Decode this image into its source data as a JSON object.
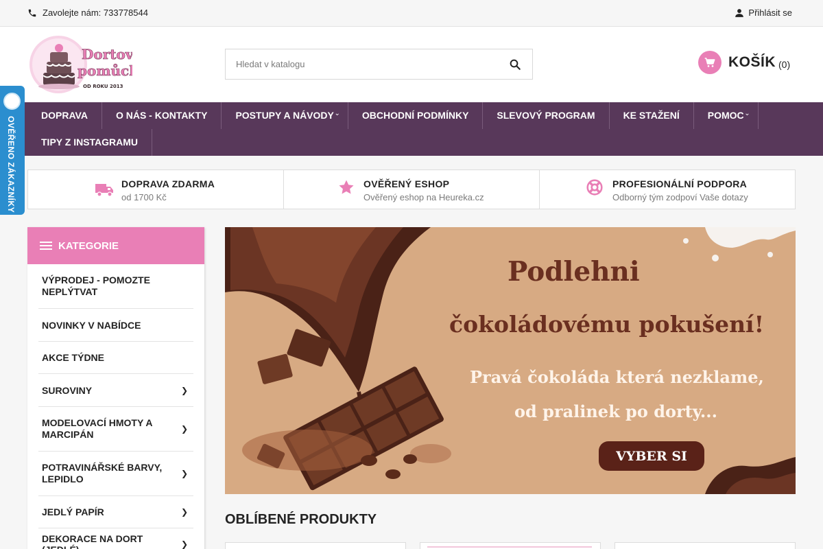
{
  "topbar": {
    "phone_text": "Zavolejte nám: 733778544",
    "login_text": "Přihlásit se"
  },
  "header": {
    "logo_icon": "cake-logo",
    "search_placeholder": "Hledat v katalogu",
    "cart_label": "KOŠÍK",
    "cart_count": "(0)"
  },
  "nav": {
    "row1": [
      {
        "label": "DOPRAVA"
      },
      {
        "label": "O NÁS - KONTAKTY"
      },
      {
        "label": "POSTUPY A NÁVODY"
      },
      {
        "label": "OBCHODNÍ PODMÍNKY"
      },
      {
        "label": "SLEVOVÝ PROGRAM"
      },
      {
        "label": "KE STAŽENÍ"
      },
      {
        "label": "POMOC"
      }
    ],
    "row2": [
      {
        "label": "TIPY Z INSTAGRAMU"
      }
    ]
  },
  "benefits": [
    {
      "icon": "truck-icon",
      "title": "DOPRAVA ZDARMA",
      "subtitle": "od 1700 Kč"
    },
    {
      "icon": "star-icon",
      "title": "OVĚŘENÝ ESHOP",
      "subtitle": "Ověřený eshop na Heureka.cz"
    },
    {
      "icon": "lifebuoy-icon",
      "title": "PROFESIONÁLNÍ PODPORA",
      "subtitle": "Odborný tým zodpoví Vaše dotazy"
    }
  ],
  "sidebar": {
    "title": "KATEGORIE",
    "items": [
      {
        "label": "VÝPRODEJ - POMOZTE NEPLÝTVAT",
        "has_children": false
      },
      {
        "label": "NOVINKY V NABÍDCE",
        "has_children": false
      },
      {
        "label": "AKCE TÝDNE",
        "has_children": false
      },
      {
        "label": "SUROVINY",
        "has_children": true
      },
      {
        "label": "MODELOVACÍ HMOTY A MARCIPÁN",
        "has_children": true
      },
      {
        "label": "POTRAVINÁŘSKÉ BARVY, LEPIDLO",
        "has_children": true
      },
      {
        "label": "JEDLÝ PAPÍR",
        "has_children": true
      },
      {
        "label": "DEKORACE NA DORT (JEDLÉ)",
        "has_children": true
      }
    ]
  },
  "banner": {
    "line1": "Podlehni",
    "line2": "čokoládovému pokušení!",
    "line3": "Pravá čokoláda která nezklame,",
    "line4": "od pralinek po dorty...",
    "cta": "VYBER SI"
  },
  "popular": {
    "title": "OBLÍBENÉ PRODUKTY"
  },
  "side_badge": {
    "text": "OVĚŘENO ZÁKAZNÍKY"
  },
  "colors": {
    "accent_pink": "#e97fb6",
    "nav_purple": "#58385a",
    "badge_blue": "#2b8ecf"
  }
}
